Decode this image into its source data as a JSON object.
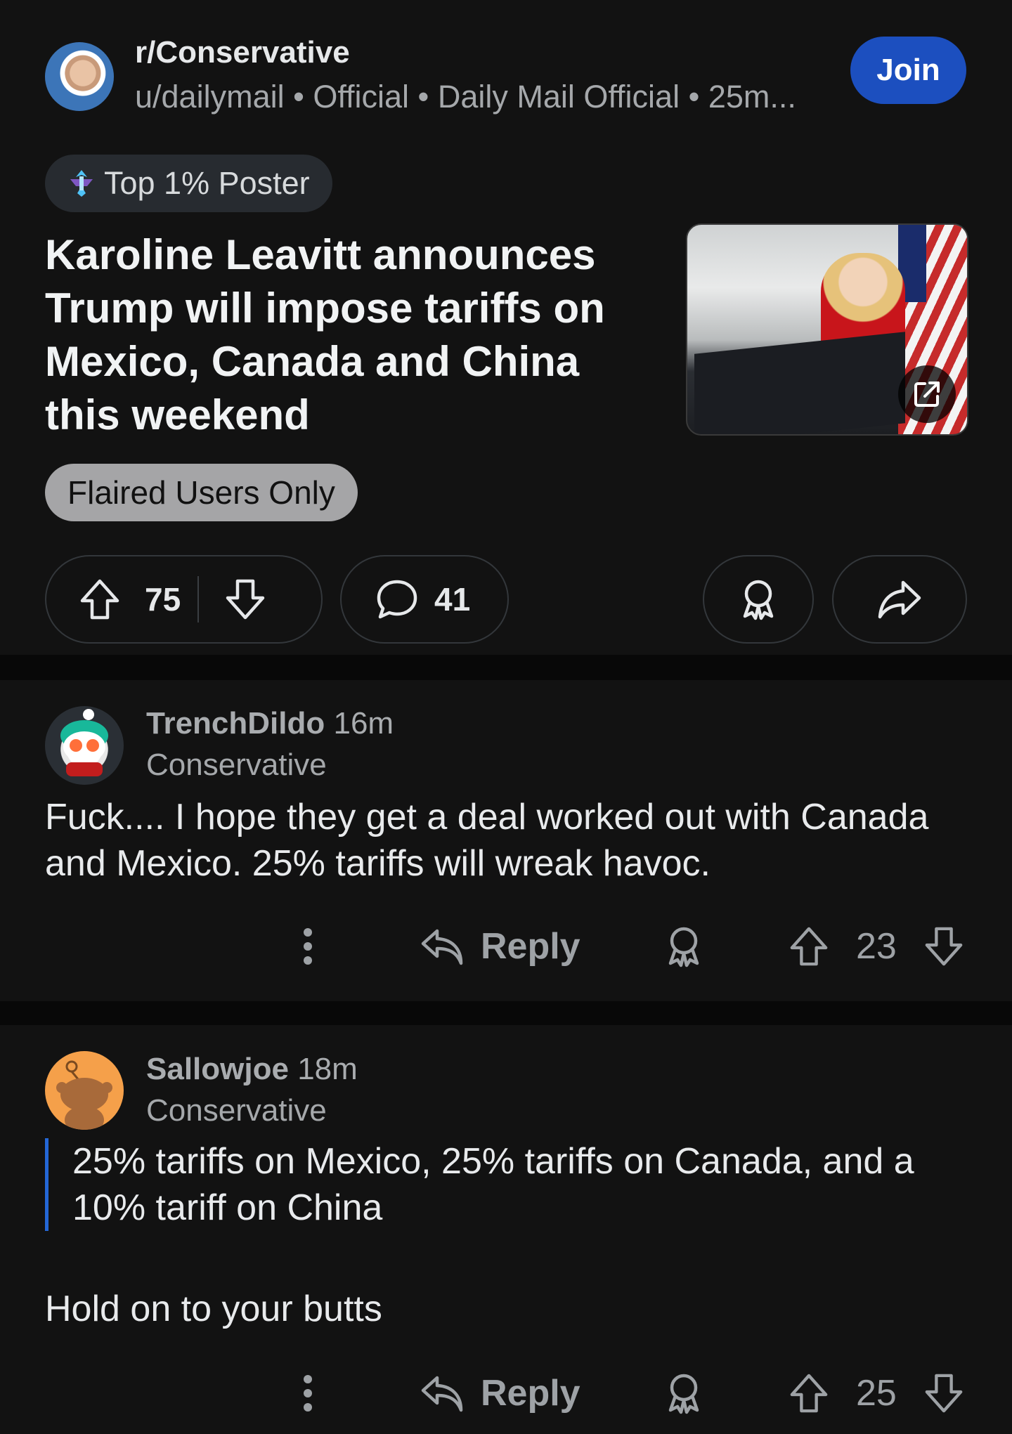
{
  "post": {
    "subreddit": "r/Conservative",
    "meta": "u/dailymail • Official • Daily Mail Official • 25m...",
    "join_label": "Join",
    "badge": "Top 1% Poster",
    "title": "Karoline Leavitt announces Trump will impose tariffs on Mexico, Canada and China this weekend",
    "flair": "Flaired Users Only",
    "score": "75",
    "comments": "41"
  },
  "comments": [
    {
      "username": "TrenchDildo",
      "time": "16m",
      "flair": "Conservative",
      "body": "Fuck.... I hope they get a deal worked out with Canada and Mexico.  25% tariffs will wreak  havoc.",
      "reply_label": "Reply",
      "score": "23"
    },
    {
      "username": "Sallowjoe",
      "time": "18m",
      "flair": "Conservative",
      "quote": "25% tariffs on Mexico, 25% tariffs on Canada, and a 10% tariff on China",
      "body": "Hold on to your butts",
      "reply_label": "Reply",
      "score": "25"
    }
  ],
  "colors": {
    "background": "#121212",
    "join_button": "#1c4fbf",
    "quote_bar": "#2467d6",
    "flair_pill": "#a5a5a7"
  },
  "icons": [
    "top-poster-icon",
    "upvote-icon",
    "downvote-icon",
    "comment-icon",
    "award-icon",
    "share-icon",
    "external-link-icon",
    "more-options-icon",
    "reply-icon"
  ]
}
